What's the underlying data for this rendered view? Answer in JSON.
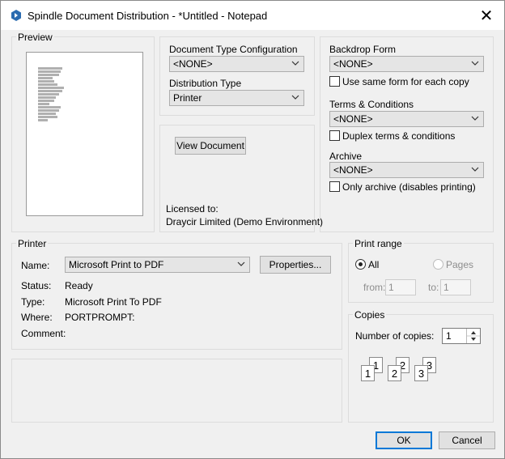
{
  "window": {
    "title": "Spindle Document Distribution - *Untitled - Notepad",
    "close_glyph": "✕"
  },
  "preview": {
    "label": "Preview"
  },
  "doc_config": {
    "type_label": "Document Type Configuration",
    "type_value": "<NONE>",
    "distribution_label": "Distribution Type",
    "distribution_value": "Printer"
  },
  "view": {
    "button_label": "View Document",
    "licensed_label": "Licensed to:",
    "licensed_value": "Draycir Limited (Demo Environment)"
  },
  "backdrop": {
    "label": "Backdrop Form",
    "value": "<NONE>",
    "same_form_label": "Use same form for each copy",
    "same_form_checked": false
  },
  "terms": {
    "label": "Terms & Conditions",
    "value": "<NONE>",
    "duplex_label": "Duplex terms & conditions",
    "duplex_checked": false
  },
  "archive": {
    "label": "Archive",
    "value": "<NONE>",
    "only_label": "Only archive (disables printing)",
    "only_checked": false
  },
  "printer": {
    "group_label": "Printer",
    "name_label": "Name:",
    "name_value": "Microsoft Print to PDF",
    "properties_label": "Properties...",
    "status_label": "Status:",
    "status_value": "Ready",
    "type_label": "Type:",
    "type_value": "Microsoft Print To PDF",
    "where_label": "Where:",
    "where_value": "PORTPROMPT:",
    "comment_label": "Comment:",
    "comment_value": ""
  },
  "print_range": {
    "group_label": "Print range",
    "all_label": "All",
    "pages_label": "Pages",
    "selected": "All",
    "from_label": "from:",
    "from_value": "1",
    "to_label": "to:",
    "to_value": "1"
  },
  "copies": {
    "group_label": "Copies",
    "number_label": "Number of copies:",
    "number_value": "1",
    "collate_sheets": [
      "1",
      "1",
      "2",
      "2",
      "3",
      "3"
    ]
  },
  "footer": {
    "ok_label": "OK",
    "cancel_label": "Cancel"
  },
  "colors": {
    "accent": "#0078d7",
    "app_icon": "#2b6cb0"
  }
}
